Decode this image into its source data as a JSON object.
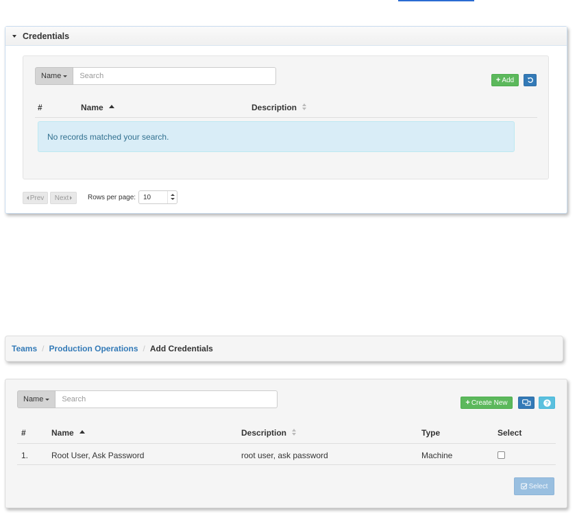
{
  "credentials_panel": {
    "title": "Credentials",
    "search": {
      "filter_label": "Name",
      "placeholder": "Search"
    },
    "add_label": "Add",
    "columns": {
      "num": "#",
      "name": "Name",
      "description": "Description"
    },
    "empty_message": "No records matched your search.",
    "pagination": {
      "prev": "Prev",
      "next": "Next",
      "rows_per_page_label": "Rows per page:",
      "rows_per_page_value": "10"
    }
  },
  "breadcrumb": {
    "teams": "Teams",
    "team": "Production Operations",
    "current": "Add Credentials"
  },
  "selection_panel": {
    "search": {
      "filter_label": "Name",
      "placeholder": "Search"
    },
    "create_new_label": "Create New",
    "columns": {
      "num": "#",
      "name": "Name",
      "description": "Description",
      "type": "Type",
      "select": "Select"
    },
    "rows": [
      {
        "num": "1.",
        "name": "Root User, Ask Password",
        "description": "root user, ask password",
        "type": "Machine",
        "selected": false
      }
    ],
    "select_label": "Select"
  },
  "icons": {
    "add": "plus-icon",
    "refresh": "refresh-icon",
    "chat": "chat-bubbles-icon",
    "help": "question-icon",
    "check": "check-square-icon"
  }
}
